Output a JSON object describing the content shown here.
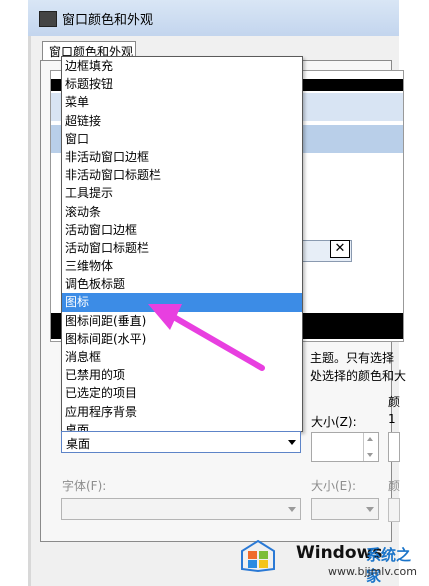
{
  "window": {
    "title": "窗口颜色和外观"
  },
  "tab": {
    "label": "窗口颜色和外观"
  },
  "item_list": [
    "边框填充",
    "标题按钮",
    "菜单",
    "超链接",
    "窗口",
    "非活动窗口边框",
    "非活动窗口标题栏",
    "工具提示",
    "滚动条",
    "活动窗口边框",
    "活动窗口标题栏",
    "三维物体",
    "调色板标题",
    "图标",
    "图标间距(垂直)",
    "图标间距(水平)",
    "消息框",
    "已禁用的项",
    "已选定的项目",
    "应用程序背景",
    "桌面"
  ],
  "selected_item": "图标",
  "preview": {
    "close_glyph": "✕"
  },
  "hint_lines": [
    "主题。只有选择",
    "处选择的颜色和大"
  ],
  "item_select": {
    "value": "桌面"
  },
  "size1": {
    "label": "大小(Z):",
    "value": ""
  },
  "color1_label": "颜",
  "color1_digit": "1",
  "font": {
    "label": "字体(F):",
    "value": ""
  },
  "size2": {
    "label": "大小(E):",
    "value": ""
  },
  "color2_label": "颜",
  "watermark": {
    "brand": "Windows",
    "cn": "系统之家",
    "url": "www.bjjmlv.com"
  },
  "colors": {
    "selection": "#3c8ce6",
    "arrow": "#e83fe0",
    "accent": "#1a74c9"
  }
}
